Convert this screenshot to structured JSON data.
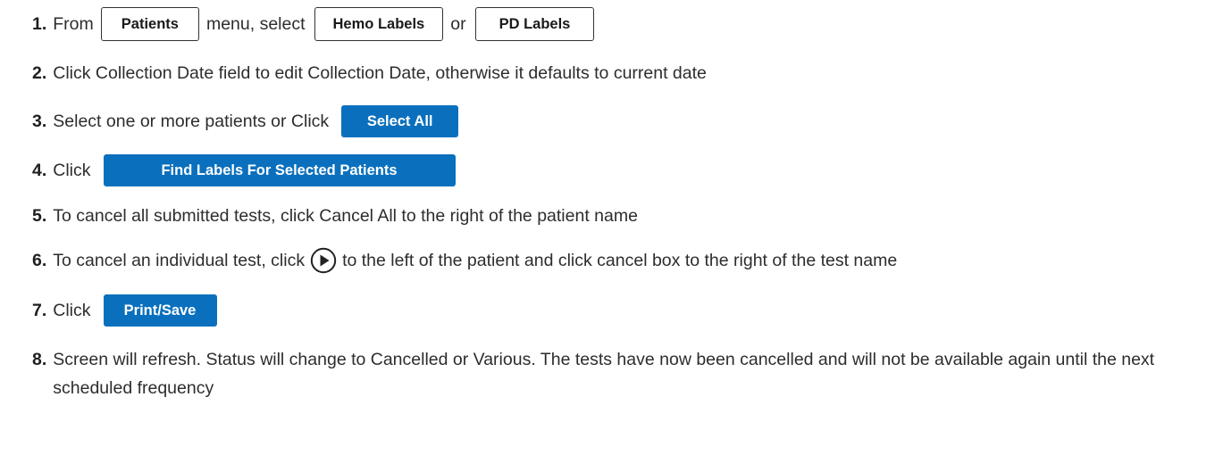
{
  "steps": [
    {
      "num": "1.",
      "text_a": "From",
      "button_patients": "Patients",
      "text_b": "menu, select",
      "button_hemo": "Hemo Labels",
      "text_c": "or",
      "button_pd": "PD Labels"
    },
    {
      "num": "2.",
      "text": "Click Collection Date field to edit Collection Date, otherwise it defaults to current date"
    },
    {
      "num": "3.",
      "text": "Select one or more patients or Click",
      "button": "Select All"
    },
    {
      "num": "4.",
      "text": "Click",
      "button": "Find Labels For Selected Patients"
    },
    {
      "num": "5.",
      "text": "To cancel all submitted tests, click Cancel All to the right of the patient name"
    },
    {
      "num": "6.",
      "text_a": "To cancel an individual test, click",
      "icon": "play-circle-icon",
      "text_b": "to the left of the patient and click cancel box to the right of the test name"
    },
    {
      "num": "7.",
      "text": "Click",
      "button": "Print/Save"
    },
    {
      "num": "8.",
      "text": "Screen will refresh.  Status will change to Cancelled or Various.  The tests have now been cancelled and will not be available again until the next scheduled frequency"
    }
  ],
  "colors": {
    "button_blue": "#0a70bd",
    "text": "#2d2d2d"
  }
}
